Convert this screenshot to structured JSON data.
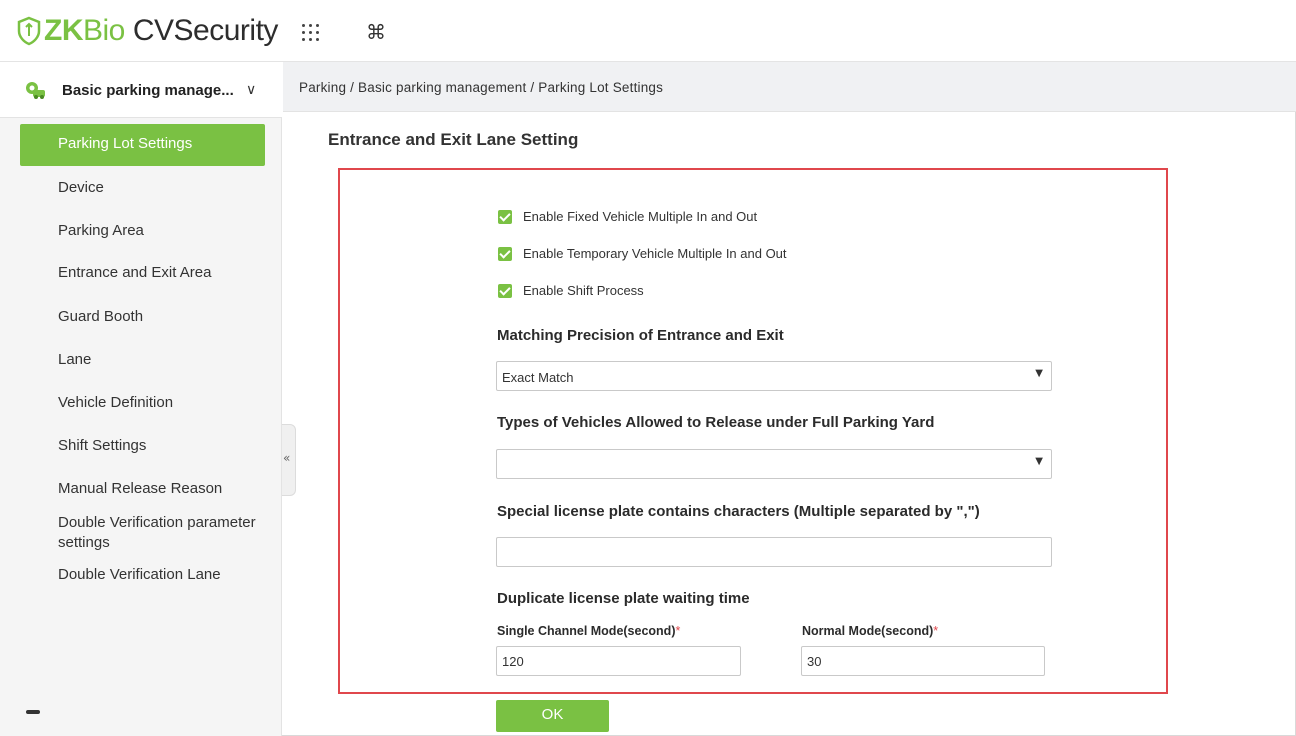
{
  "header": {
    "logo_zk": "ZK",
    "logo_bio": "Bio",
    "logo_rest": "CVSecurity",
    "apps_icon": "grid-apps-icon",
    "command_icon": "⌘"
  },
  "sidebar": {
    "module_title": "Basic parking manage...",
    "module_chevron": "∨",
    "active_item": "Parking Lot Settings",
    "items": [
      "Device",
      "Parking Area",
      "Entrance and Exit Area",
      "Guard Booth",
      "Lane",
      "Vehicle Definition",
      "Shift Settings",
      "Manual Release Reason",
      "Double Verification parameter settings",
      "Double Verification Lane"
    ],
    "collapse_glyph": "«"
  },
  "breadcrumb": "Parking / Basic parking management / Parking Lot Settings",
  "form": {
    "title": "Entrance and Exit Lane Setting",
    "checkboxes": [
      {
        "label": "Enable Fixed Vehicle Multiple In and Out",
        "checked": true
      },
      {
        "label": "Enable Temporary Vehicle Multiple In and Out",
        "checked": true
      },
      {
        "label": "Enable Shift Process",
        "checked": true
      }
    ],
    "matching_label": "Matching Precision of Entrance and Exit",
    "matching_value": "Exact Match",
    "vehicle_types_label": "Types of Vehicles Allowed to Release under Full Parking Yard",
    "vehicle_types_value": "",
    "special_plate_label": "Special license plate contains characters  (Multiple separated by \",\")",
    "special_plate_value": "",
    "duplicate_label": "Duplicate license plate waiting time",
    "single_channel_label": "Single Channel Mode(second)",
    "single_channel_value": "120",
    "normal_mode_label": "Normal Mode(second)",
    "normal_mode_value": "30",
    "required_mark": "*",
    "select_arrow": "▼",
    "ok_label": "OK"
  },
  "colors": {
    "accent": "#7ac143",
    "highlight_border": "#e0474c"
  }
}
